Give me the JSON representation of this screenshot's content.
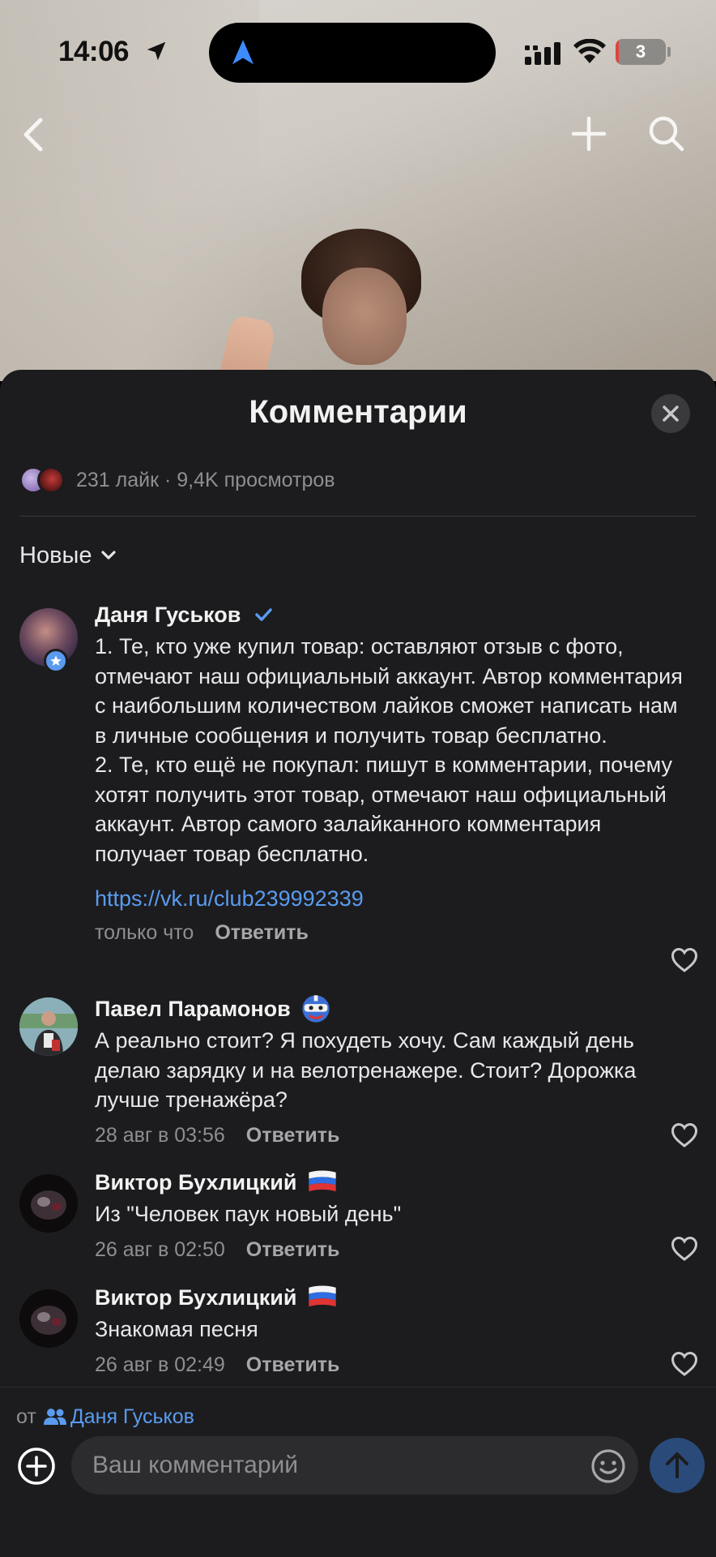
{
  "status_bar": {
    "time": "14:06",
    "battery_level": "3",
    "battery_fraction": 0.03
  },
  "colors": {
    "accent": "#5a9bf0",
    "sheet_bg": "#1c1c1e",
    "battery_low": "#e0443d"
  },
  "icons": {
    "nav": [
      "back-chevron-icon",
      "plus-icon",
      "search-icon"
    ],
    "status": [
      "location-arrow-icon",
      "cellular-signal-icon",
      "wifi-icon",
      "battery-icon"
    ]
  },
  "sheet": {
    "title": "Комментарии",
    "stats": "231 лайк · 9,4K просмотров",
    "sort_label": "Новые"
  },
  "comments": [
    {
      "author": "Даня Гуськов",
      "badge": "verified-check-icon",
      "text": "1. Те, кто уже купил товар: оставляют отзыв с фото, отмечают наш официальный аккаунт. Автор комментария с наибольшим количеством лайков сможет написать нам в личные сообщения и получить товар бесплатно.\n2. Те, кто ещё не покупал: пишут в комментарии, почему хотят получить этот товар, отмечают наш официальный аккаунт. Автор самого залайканного комментария получает товар бесплатно.",
      "link": "https://vk.ru/club239992339",
      "time": "только что",
      "reply": "Ответить"
    },
    {
      "author": "Павел Парамонов",
      "badge": "superhero-emoji-icon",
      "text": "А реально стоит? Я похудеть хочу. Сам каждый день делаю зарядку и на велотренажере. Стоит? Дорожка лучше тренажёра?",
      "time": "28 авг в 03:56",
      "reply": "Ответить"
    },
    {
      "author": "Виктор Бухлицкий",
      "badge": "russia-flag-icon",
      "text": "Из \"Человек паук новый день\"",
      "time": "26 авг в 02:50",
      "reply": "Ответить"
    },
    {
      "author": "Виктор Бухлицкий",
      "badge": "russia-flag-icon",
      "text": "Знакомая песня",
      "time": "26 авг в 02:49",
      "reply": "Ответить"
    }
  ],
  "composer": {
    "from_label": "от",
    "from_name": "Даня Гуськов",
    "placeholder": "Ваш комментарий"
  }
}
